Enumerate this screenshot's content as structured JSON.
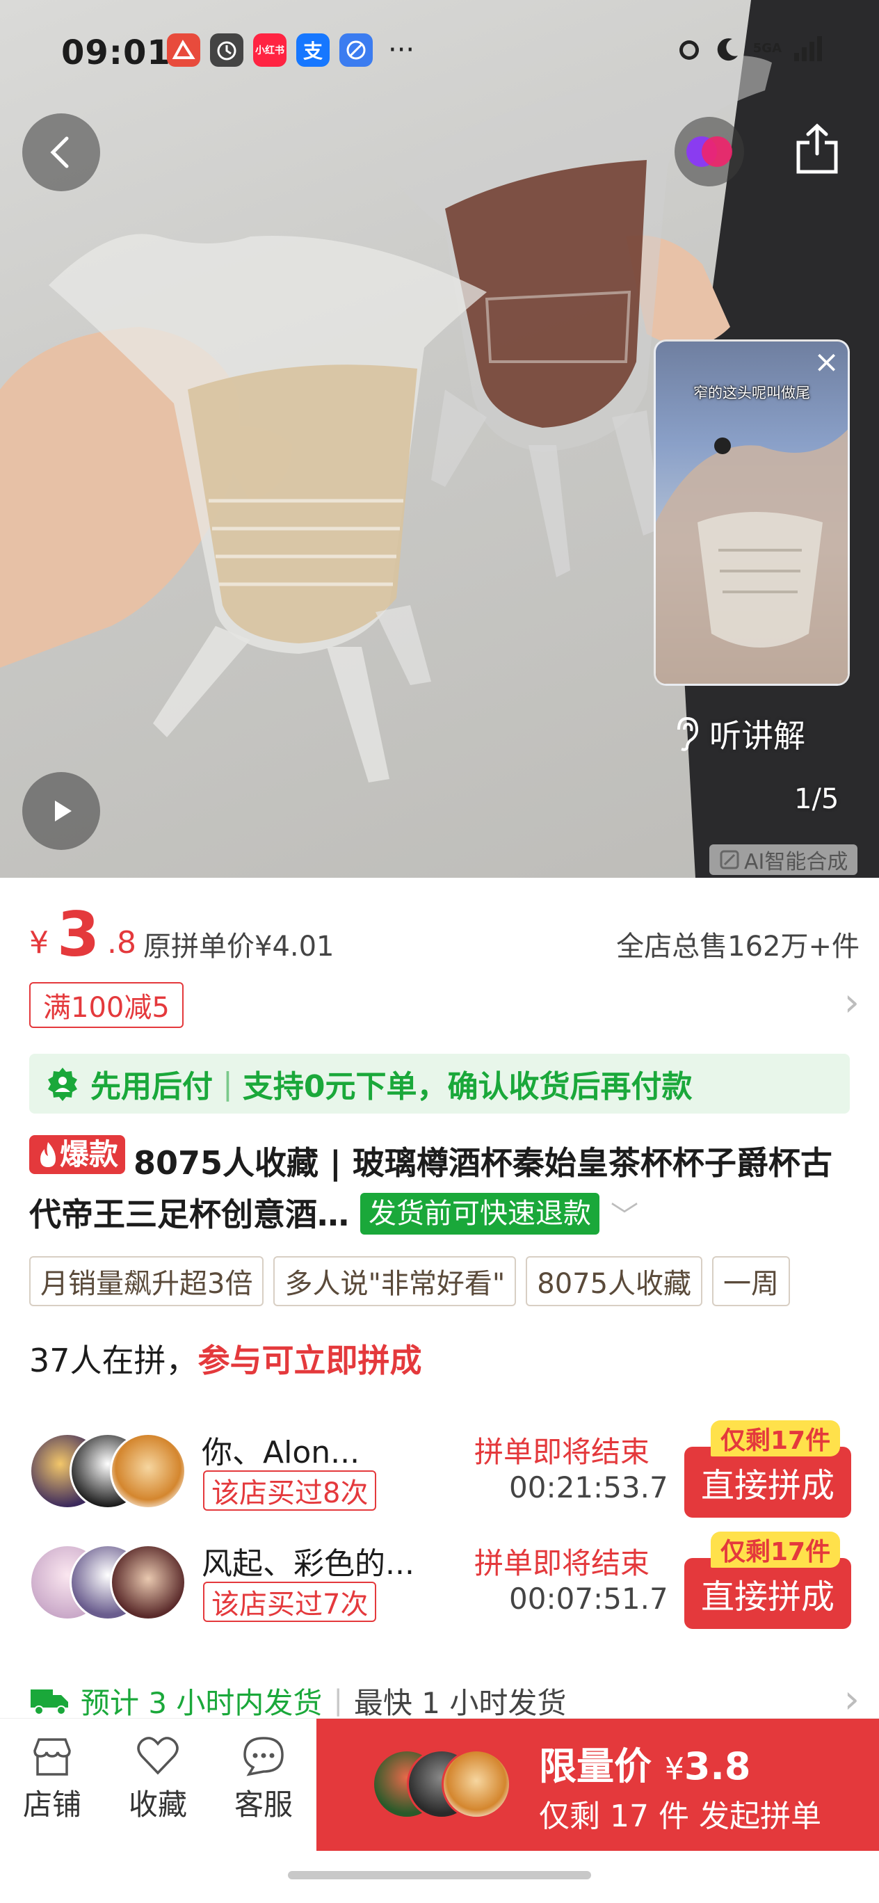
{
  "status_bar": {
    "time": "09:01",
    "apps": [
      {
        "name": "news-app-icon",
        "label": "",
        "color": "#e84b3c"
      },
      {
        "name": "alarm-app-icon",
        "label": "",
        "color": "#444444"
      },
      {
        "name": "xiaohongshu-app-icon",
        "label": "小红书",
        "color": "#ff2442"
      },
      {
        "name": "alipay-app-icon",
        "label": "支",
        "color": "#1677ff"
      },
      {
        "name": "browser-app-icon",
        "label": "",
        "color": "#3b7cf0"
      }
    ],
    "more": "···",
    "network": "5GA"
  },
  "hero": {
    "video_caption": "窄的这头呢叫做尾",
    "listen_label": "听讲解",
    "page_indicator": "1/5",
    "ai_label": "AI智能合成"
  },
  "price": {
    "symbol": "¥",
    "integer": "3",
    "decimal": ".8",
    "original": "原拼单价¥4.01",
    "total_sold": "全店总售162万+件"
  },
  "coupon": {
    "label": "满100减5"
  },
  "pay_later": {
    "title": "先用后付",
    "separator": "|",
    "desc": "支持0元下单，确认收货后再付款"
  },
  "product": {
    "hot_tag": "爆款",
    "title": "8075人收藏 | 玻璃樽酒杯秦始皇茶杯杯子爵杯古代帝王三足杯创意酒…",
    "refund_tag": "发货前可快速退款"
  },
  "tags": [
    "月销量飙升超3倍",
    "多人说\"非常好看\"",
    "8075人收藏",
    "一周"
  ],
  "group": {
    "count_text": "37人在拼，",
    "highlight": "参与可立即拼成",
    "rows": [
      {
        "name": "你、Alon...",
        "badge": "该店买过8次",
        "ending": "拼单即将结束",
        "timer": "00:21:53.7",
        "remain": "仅剩17件",
        "button": "直接拼成"
      },
      {
        "name": "风起、彩色的...",
        "badge": "该店买过7次",
        "ending": "拼单即将结束",
        "timer": "00:07:51.7",
        "remain": "仅剩17件",
        "button": "直接拼成"
      }
    ]
  },
  "shipping": {
    "estimate": "预计 3 小时内发货",
    "separator": "|",
    "fastest": "最快 1 小时发货"
  },
  "bottom_bar": {
    "store": "店铺",
    "favorite": "收藏",
    "service": "客服",
    "cta_label": "限量价",
    "cta_symbol": "¥",
    "cta_price": "3.8",
    "cta_sub": "仅剩 17 件 发起拼单"
  },
  "colors": {
    "accent": "#e4393c",
    "green": "#1aa83a",
    "highlight_yellow": "#ffe14b"
  }
}
